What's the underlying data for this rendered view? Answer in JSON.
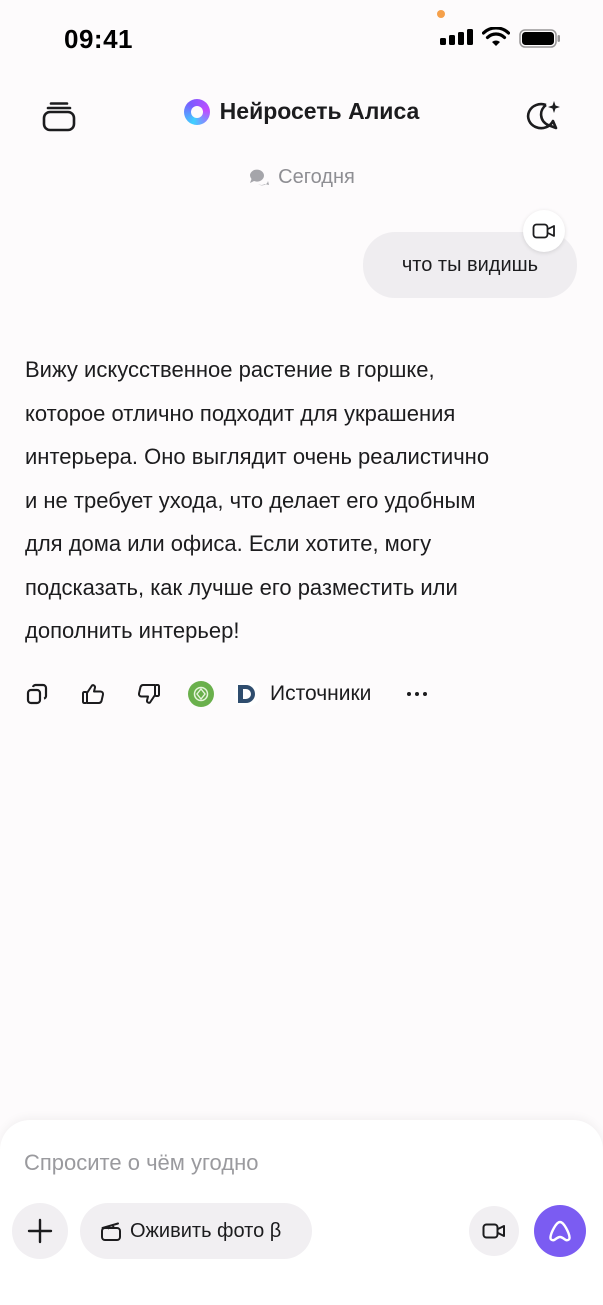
{
  "status_bar": {
    "time": "09:41"
  },
  "header": {
    "title": "Нейросеть Алиса"
  },
  "chat": {
    "date_label": "Сегодня",
    "user_message": "что ты видишь",
    "assistant_lines": [
      "Вижу искусственное растение в горшке,",
      "которое отлично подходит для украшения",
      "интерьера. Оно выглядит очень реалистично",
      "и не требует ухода, что делает его удобным",
      "для дома или офиса. Если хотите, могу",
      "подсказать, как лучше его разместить или",
      "дополнить интерьер!"
    ],
    "actions": {
      "sources_label": "Источники"
    }
  },
  "composer": {
    "placeholder": "Спросите о чём угодно",
    "animate_photo_label": "Оживить фото β"
  },
  "colors": {
    "accent": "#7b5cf2",
    "status_dot": "#f5a04a",
    "source_green": "#6ab04c"
  },
  "icons": [
    "history-stack-icon",
    "new-chat-icon",
    "chat-bubbles-icon",
    "video-camera-icon",
    "copy-icon",
    "thumbs-up-icon",
    "thumbs-down-icon",
    "source-site-icon",
    "source-d-icon",
    "more-icon",
    "plus-icon",
    "clapperboard-icon",
    "alice-icon"
  ]
}
